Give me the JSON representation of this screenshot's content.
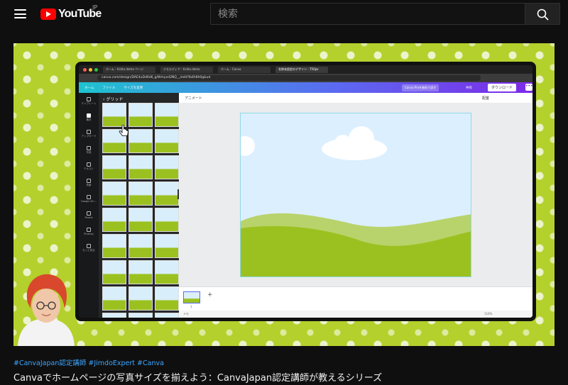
{
  "header": {
    "logo_text": "YouTube",
    "country": "JP",
    "search_placeholder": "検索"
  },
  "video": {
    "hashtags": "#CanvaJapan認定講師 #JimdoExpert #Canva",
    "title": "Canvaでホームページの写真サイズを揃えよう：CanvaJapan認定講師が教えるシリーズ"
  },
  "browser": {
    "tabs": [
      "ホーム - ticktu demo ページ",
      "ジモエディア - ticktu demo",
      "ホーム - Canva",
      "名称未設定のデザイン - 750px"
    ],
    "url": "canva.com/design/DAE4uDd6d6_g/Wmyxd2NQ__/edit?lb4h8h0g&ud"
  },
  "canva": {
    "menu": [
      "ホーム",
      "ファイル",
      "サイズを変更"
    ],
    "pro_label": "Canva Proを無料で試す",
    "share_label": "共有",
    "download_label": "ダウンロード",
    "more_label": "•••",
    "animate_label": "アニメート",
    "edit_label": "配置",
    "panel_title": "グリッド",
    "rail": [
      "テンプレート",
      "素材",
      "アップロード",
      "写真",
      "テキスト",
      "背景",
      "Google Dri...",
      "Pexels",
      "Pixabay",
      "もっと見る"
    ],
    "memo_label": "メモ",
    "zoom_label": "116%",
    "page_number": "1"
  }
}
